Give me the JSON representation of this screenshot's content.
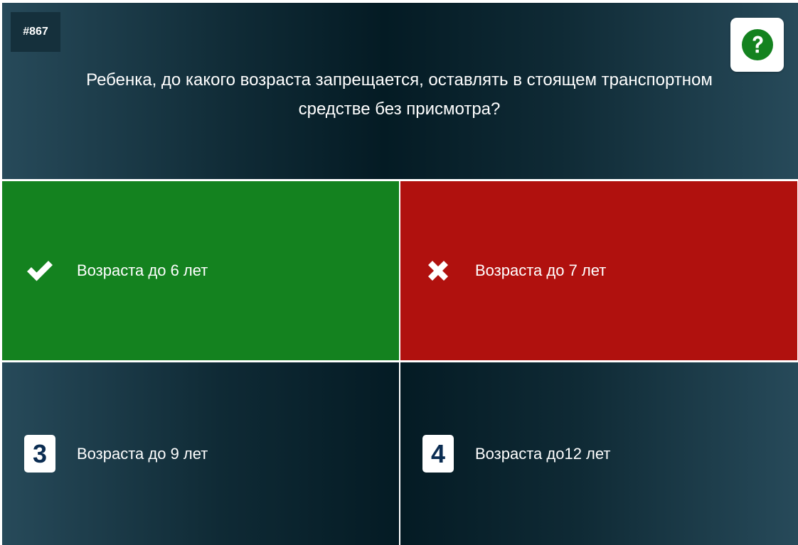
{
  "question": {
    "number": "#867",
    "text": "Ребенка, до какого возраста запрещается, оставлять в стоящем транспортном средстве без присмотра?"
  },
  "help": {
    "icon": "question-circle-icon",
    "color": "#14821f"
  },
  "answers": [
    {
      "marker": "check-icon",
      "label": "Возраста до 6 лет",
      "state": "correct",
      "color": "#14821f"
    },
    {
      "marker": "cross-icon",
      "label": "Возраста до 7 лет",
      "state": "wrong",
      "color": "#b0110e"
    },
    {
      "marker": "3",
      "label": "Возраста до 9 лет",
      "state": "neutral"
    },
    {
      "marker": "4",
      "label": "Возраста до12 лет",
      "state": "neutral"
    }
  ]
}
